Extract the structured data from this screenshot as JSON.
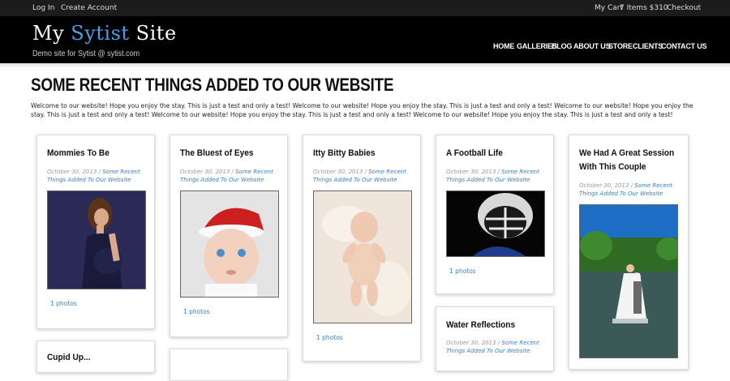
{
  "topbar": {
    "login": "Log In",
    "create_account": "Create Account",
    "cart": "My Cart",
    "cart_summary": "7 Items $310",
    "checkout": "Checkout"
  },
  "header": {
    "logo_part1": "My ",
    "logo_highlight": "Sytist",
    "logo_part2": " Site",
    "tagline": "Demo site for Sytist @ sytist.com"
  },
  "nav": [
    "HOME",
    "GALLERIES",
    "BLOG",
    "ABOUT US",
    "STORE",
    "CLIENTS",
    "CONTACT US"
  ],
  "page": {
    "title": "SOME RECENT THINGS ADDED TO OUR WEBSITE",
    "intro": "Welcome to our website! Hope you enjoy the stay. This is just a test and only a test! Welcome to our website! Hope you enjoy the stay. This is just a test and only a test! Welcome to our website! Hope you enjoy the stay. This is just a test and only a test! Welcome to our website! Hope you enjoy the stay. This is just a test and only a test! Welcome to our website! Hope you enjoy the stay. This is just a test and only a test!"
  },
  "posts": [
    {
      "title": "Mommies To Be",
      "date": "October 30, 2013",
      "category": "Some Recent Things Added To Our Website",
      "photos": "1 photos"
    },
    {
      "title": "The Bluest of Eyes",
      "date": "October 30, 2013",
      "category": "Some Recent Things Added To Our Website",
      "photos": "1 photos"
    },
    {
      "title": "Itty Bitty Babies",
      "date": "October 30, 2013",
      "category": "Some Recent Things Added To Our Website",
      "photos": "1 photos"
    },
    {
      "title": "A Football Life",
      "date": "October 30, 2013",
      "category": "Some Recent Things Added To Our Website",
      "photos": "1 photos"
    },
    {
      "title": "We Had A Great Session",
      "title2": "With This Couple",
      "date": "October 30, 2013",
      "category": "Some Recent Things Added To Our Website"
    },
    {
      "title": "Water Reflections",
      "date": "October 30, 2013",
      "category": "Some Recent Things Added To Our Website"
    },
    {
      "title": "Cupid Up..."
    }
  ],
  "meta_sep": " / ",
  "colors": {
    "accent": "#4a9ee8",
    "link": "#3a7ec0",
    "header_bg": "#000000",
    "topbar_bg": "#1c1c1c"
  }
}
